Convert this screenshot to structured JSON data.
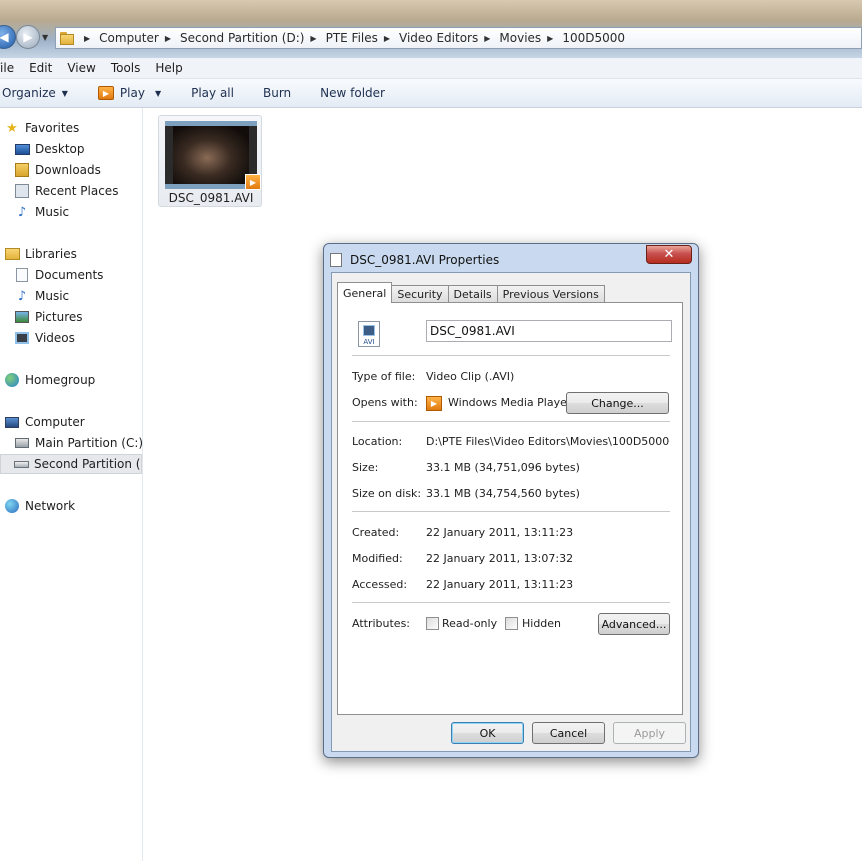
{
  "explorer": {
    "breadcrumb": [
      "Computer",
      "Second Partition (D:)",
      "PTE Files",
      "Video Editors",
      "Movies",
      "100D5000"
    ],
    "menu": [
      "File",
      "Edit",
      "View",
      "Tools",
      "Help"
    ],
    "toolbar": {
      "organize": "Organize",
      "play": "Play",
      "play_all": "Play all",
      "burn": "Burn",
      "new_folder": "New folder"
    },
    "sidebar": {
      "favorites": "Favorites",
      "desktop": "Desktop",
      "downloads": "Downloads",
      "recent_places": "Recent Places",
      "music_fav": "Music",
      "libraries": "Libraries",
      "documents": "Documents",
      "music_lib": "Music",
      "pictures": "Pictures",
      "videos": "Videos",
      "homegroup": "Homegroup",
      "computer": "Computer",
      "main_partition": "Main Partition (C:)",
      "second_partition": "Second Partition (D:)",
      "network": "Network"
    },
    "file": {
      "name": "DSC_0981.AVI"
    }
  },
  "dialog": {
    "title": "DSC_0981.AVI Properties",
    "close_glyph": "✕",
    "tabs": [
      "General",
      "Security",
      "Details",
      "Previous Versions"
    ],
    "icon_caption": "AVI",
    "file_name_value": "DSC_0981.AVI",
    "labels": {
      "type": "Type of file:",
      "opens": "Opens with:",
      "location": "Location:",
      "size": "Size:",
      "size_on_disk": "Size on disk:",
      "created": "Created:",
      "modified": "Modified:",
      "accessed": "Accessed:",
      "attributes": "Attributes:"
    },
    "values": {
      "type": "Video Clip (.AVI)",
      "opens": "Windows Media Player",
      "location": "D:\\PTE Files\\Video Editors\\Movies\\100D5000",
      "size": "33.1 MB (34,751,096 bytes)",
      "size_on_disk": "33.1 MB (34,754,560 bytes)",
      "created": "22 January 2011, 13:11:23",
      "modified": "22 January 2011, 13:07:32",
      "accessed": "22 January 2011, 13:11:23"
    },
    "attributes": {
      "read_only": "Read-only",
      "hidden": "Hidden"
    },
    "buttons": {
      "change": "Change...",
      "advanced": "Advanced...",
      "ok": "OK",
      "cancel": "Cancel",
      "apply": "Apply"
    }
  }
}
